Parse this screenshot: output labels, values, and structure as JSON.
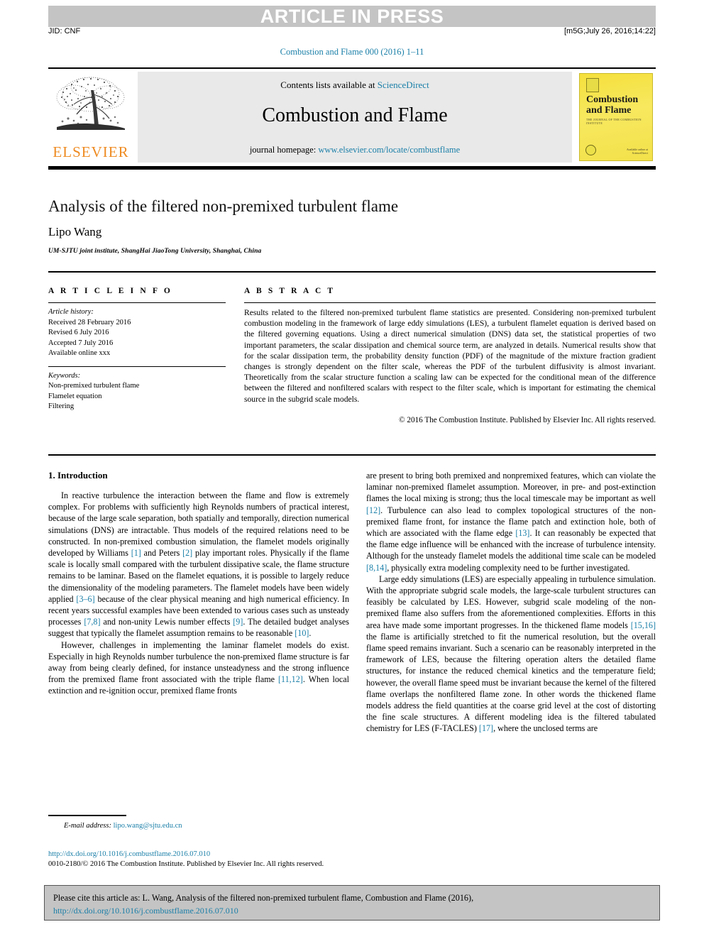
{
  "header": {
    "banner_text": "ARTICLE IN PRESS",
    "jid": "JID: CNF",
    "stamp": "[m5G;July 26, 2016;14:22]",
    "journal_ref": "Combustion and Flame 000 (2016) 1–11"
  },
  "masthead": {
    "publisher": "ELSEVIER",
    "contents_prefix": "Contents lists available at ",
    "contents_link": "ScienceDirect",
    "journal_name": "Combustion and Flame",
    "homepage_prefix": "journal homepage: ",
    "homepage_url": "www.elsevier.com/locate/combustflame",
    "cover_title": "Combustion and Flame",
    "cover_subtitle": "THE JOURNAL OF THE COMBUSTION INSTITUTE",
    "cover_footer": "Available online at\nScienceDirect"
  },
  "article": {
    "title": "Analysis of the filtered non-premixed turbulent flame",
    "author": "Lipo Wang",
    "affiliation": "UM-SJTU joint institute, ShangHai JiaoTong University, Shanghai, China"
  },
  "info": {
    "heading": "A R T I C L E   I N F O",
    "history_label": "Article history:",
    "history": [
      "Received 28 February 2016",
      "Revised 6 July 2016",
      "Accepted 7 July 2016",
      "Available online xxx"
    ],
    "keywords_label": "Keywords:",
    "keywords": [
      "Non-premixed turbulent flame",
      "Flamelet equation",
      "Filtering"
    ]
  },
  "abstract": {
    "heading": "A B S T R A C T",
    "text": "Results related to the filtered non-premixed turbulent flame statistics are presented. Considering non-premixed turbulent combustion modeling in the framework of large eddy simulations (LES), a turbulent flamelet equation is derived based on the filtered governing equations. Using a direct numerical simulation (DNS) data set, the statistical properties of two important parameters, the scalar dissipation and chemical source term, are analyzed in details. Numerical results show that for the scalar dissipation term, the probability density function (PDF) of the magnitude of the mixture fraction gradient changes is strongly dependent on the filter scale, whereas the PDF of the turbulent diffusivity is almost invariant. Theoretically from the scalar structure function a scaling law can be expected for the conditional mean of the difference between the filtered and nonfiltered scalars with respect to the filter scale, which is important for estimating the chemical source in the subgrid scale models.",
    "copyright": "© 2016 The Combustion Institute. Published by Elsevier Inc. All rights reserved."
  },
  "body": {
    "section_heading": "1. Introduction",
    "left_paragraphs": [
      "In reactive turbulence the interaction between the flame and flow is extremely complex. For problems with sufficiently high Reynolds numbers of practical interest, because of the large scale separation, both spatially and temporally, direction numerical simulations (DNS) are intractable. Thus models of the required relations need to be constructed. In non-premixed combustion simulation, the flamelet models originally developed by Williams [1] and Peters [2] play important roles. Physically if the flame scale is locally small compared with the turbulent dissipative scale, the flame structure remains to be laminar. Based on the flamelet equations, it is possible to largely reduce the dimensionality of the modeling parameters. The flamelet models have been widely applied [3–6] because of the clear physical meaning and high numerical efficiency. In recent years successful examples have been extended to various cases such as unsteady processes [7,8] and non-unity Lewis number effects [9]. The detailed budget analyses suggest that typically the flamelet assumption remains to be reasonable [10].",
      "However, challenges in implementing the laminar flamelet models do exist. Especially in high Reynolds number turbulence the non-premixed flame structure is far away from being clearly defined, for instance unsteadyness and the strong influence from the premixed flame front associated with the triple flame [11,12]. When local extinction and re-ignition occur, premixed flame fronts"
    ],
    "right_paragraphs": [
      "are present to bring both premixed and nonpremixed features, which can violate the laminar non-premixed flamelet assumption. Moreover, in pre- and post-extinction flames the local mixing is strong; thus the local timescale may be important as well [12]. Turbulence can also lead to complex topological structures of the non-premixed flame front, for instance the flame patch and extinction hole, both of which are associated with the flame edge [13]. It can reasonably be expected that the flame edge influence will be enhanced with the increase of turbulence intensity. Although for the unsteady flamelet models the additional time scale can be modeled [8,14], physically extra modeling complexity need to be further investigated.",
      "Large eddy simulations (LES) are especially appealing in turbulence simulation. With the appropriate subgrid scale models, the large-scale turbulent structures can feasibly be calculated by LES. However, subgrid scale modeling of the non-premixed flame also suffers from the aforementioned complexities. Efforts in this area have made some important progresses. In the thickened flame models [15,16] the flame is artificially stretched to fit the numerical resolution, but the overall flame speed remains invariant. Such a scenario can be reasonably interpreted in the framework of LES, because the filtering operation alters the detailed flame structures, for instance the reduced chemical kinetics and the temperature field; however, the overall flame speed must be invariant because the kernel of the filtered flame overlaps the nonfiltered flame zone. In other words the thickened flame models address the field quantities at the coarse grid level at the cost of distorting the fine scale structures. A different modeling idea is the filtered tabulated chemistry for LES (F-TACLES) [17], where the unclosed terms are"
    ]
  },
  "footnote": {
    "email_label": "E-mail address:",
    "email": "lipo.wang@sjtu.edu.cn",
    "doi": "http://dx.doi.org/10.1016/j.combustflame.2016.07.010",
    "issn": "0010-2180/© 2016 The Combustion Institute. Published by Elsevier Inc. All rights reserved."
  },
  "cite_box": {
    "text": "Please cite this article as: L. Wang, Analysis of the filtered non-premixed turbulent flame, Combustion and Flame (2016),",
    "url": "http://dx.doi.org/10.1016/j.combustflame.2016.07.010"
  },
  "colors": {
    "link": "#1a7fa8",
    "banner_gray": "#c4c4c4",
    "elsevier_orange": "#ee8b22",
    "cover_yellow": "#f5e03c"
  }
}
